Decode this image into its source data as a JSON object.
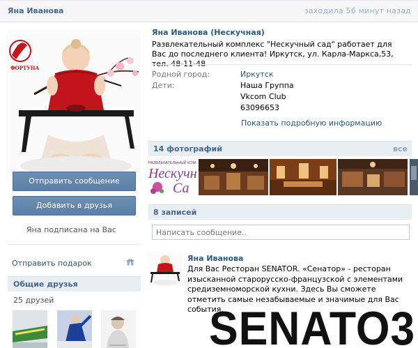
{
  "header": {
    "user_name": "Яна Иванова",
    "last_seen": "заходила 56 минут назад"
  },
  "profile": {
    "full_name": "Яна Иванова (Нескучная)",
    "status": "Развлекательный комплекс \"Нескучный сад\" работает для Вас до последнего клиента! Иркутск, ул. Карла-Маркса,53, тел. 48-11-48",
    "info": [
      {
        "label": "Родной город:",
        "values": [
          "Иркутск"
        ]
      },
      {
        "label": "Дети:",
        "values": [
          "Наша Группа",
          "Vkcom Club",
          "63096653"
        ]
      }
    ],
    "more_info_link": "Показать подробную информацию",
    "photo_watermark": "ФОРТУНА"
  },
  "actions": {
    "send_message": "Отправить сообщение",
    "add_friend": "Добавить в друзья",
    "subscribed_note": "Яна подписана на Вас",
    "send_gift": "Отправить подарок"
  },
  "friends": {
    "title": "Общие друзья",
    "count": "25 друзей"
  },
  "photos": {
    "title": "14 фотографий",
    "all_link": "все",
    "first_caption_top": "РАЗВЛЕКАТЕЛЬНЫЙ КОМ",
    "first_caption_main": "Нескучны",
    "first_caption_sub": "Са"
  },
  "wall": {
    "title": "8 записей",
    "compose_placeholder": "Написать сообщение..",
    "post": {
      "author": "Яна Иванова",
      "text": "Для Вас Ресторан SENATOR. «Сенатор» - ресторан изысканной старорусско-французской с элементами средиземноморской кухни. Здесь Вы сможете отметить самые незабываемые и значимые для Вас события.",
      "logo_text": "SENATO3"
    }
  },
  "colors": {
    "brand": "#45688e",
    "link": "#2b587a",
    "button": "#5b7fa6",
    "bar": "#e9eef3"
  }
}
